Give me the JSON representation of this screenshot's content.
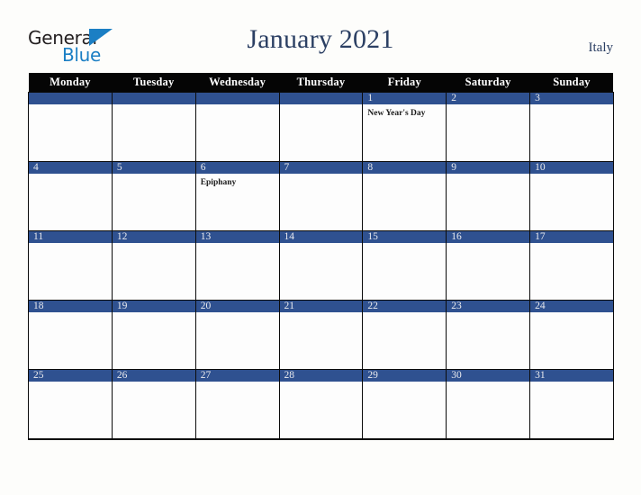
{
  "brand": {
    "name_part1": "General",
    "name_part2": "Blue",
    "triangle_icon": "triangle-icon",
    "color_dark": "#231f20",
    "color_blue": "#1b7fc4"
  },
  "header": {
    "title": "January 2021",
    "country": "Italy",
    "title_color": "#2b3f63"
  },
  "theme": {
    "header_row_bg": "#050505",
    "date_bar_bg": "#2f5190",
    "date_number_color": "#e9eaee",
    "cell_bg": "#fdfdfd",
    "page_bg": "#fdfdfb",
    "grid_line": "#0b0b0b"
  },
  "weekdays": [
    "Monday",
    "Tuesday",
    "Wednesday",
    "Thursday",
    "Friday",
    "Saturday",
    "Sunday"
  ],
  "weeks": [
    [
      {
        "day": "",
        "events": []
      },
      {
        "day": "",
        "events": []
      },
      {
        "day": "",
        "events": []
      },
      {
        "day": "",
        "events": []
      },
      {
        "day": "1",
        "events": [
          "New Year's Day"
        ]
      },
      {
        "day": "2",
        "events": []
      },
      {
        "day": "3",
        "events": []
      }
    ],
    [
      {
        "day": "4",
        "events": []
      },
      {
        "day": "5",
        "events": []
      },
      {
        "day": "6",
        "events": [
          "Epiphany"
        ]
      },
      {
        "day": "7",
        "events": []
      },
      {
        "day": "8",
        "events": []
      },
      {
        "day": "9",
        "events": []
      },
      {
        "day": "10",
        "events": []
      }
    ],
    [
      {
        "day": "11",
        "events": []
      },
      {
        "day": "12",
        "events": []
      },
      {
        "day": "13",
        "events": []
      },
      {
        "day": "14",
        "events": []
      },
      {
        "day": "15",
        "events": []
      },
      {
        "day": "16",
        "events": []
      },
      {
        "day": "17",
        "events": []
      }
    ],
    [
      {
        "day": "18",
        "events": []
      },
      {
        "day": "19",
        "events": []
      },
      {
        "day": "20",
        "events": []
      },
      {
        "day": "21",
        "events": []
      },
      {
        "day": "22",
        "events": []
      },
      {
        "day": "23",
        "events": []
      },
      {
        "day": "24",
        "events": []
      }
    ],
    [
      {
        "day": "25",
        "events": []
      },
      {
        "day": "26",
        "events": []
      },
      {
        "day": "27",
        "events": []
      },
      {
        "day": "28",
        "events": []
      },
      {
        "day": "29",
        "events": []
      },
      {
        "day": "30",
        "events": []
      },
      {
        "day": "31",
        "events": []
      }
    ]
  ]
}
